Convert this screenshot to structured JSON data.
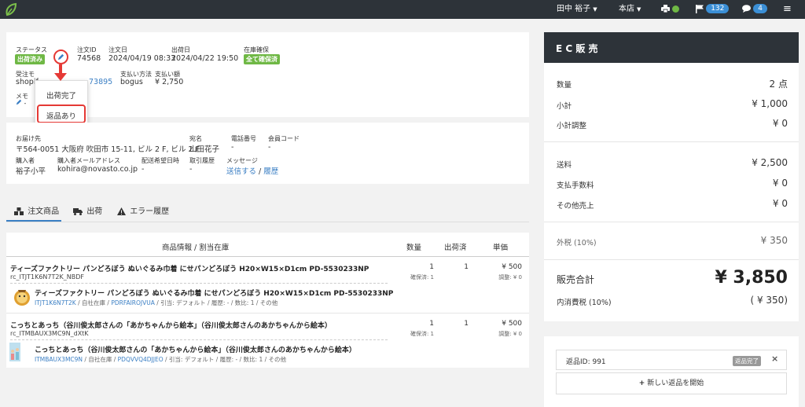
{
  "topbar": {
    "user": "田中 裕子",
    "store": "本店",
    "notifications_count": "132",
    "messages_count": "4",
    "brand_color": "#2d3339",
    "badge_color": "#3b8fd6",
    "status_dot_color": "#6fb845"
  },
  "order": {
    "status_label": "ステータス",
    "status_value": "出荷済み",
    "order_id_label": "注文ID",
    "order_id": "74568",
    "order_date_label": "注文日",
    "order_date": "2024/04/19 08:33",
    "ship_date_label": "出荷日",
    "ship_date": "2024/04/22 19:50",
    "stock_label": "在庫確保",
    "stock_value": "全て確保済",
    "source_label": "受注モ",
    "source_value": "shopif",
    "order_no_fragment": "73895",
    "payment_method_label": "支払い方法",
    "payment_method": "bogus",
    "payment_amount_label": "支払い額",
    "payment_amount": "¥ 2,750",
    "memo_label": "メモ",
    "memo_value": "-"
  },
  "status_menu": {
    "items": [
      "出荷完了",
      "返品あり"
    ]
  },
  "shipping": {
    "address_label": "お届け先",
    "address": "〒564-0051 大阪府 吹田市 15-11, ビル 2 F, ビル 2 F",
    "addressee_label": "宛名",
    "addressee": "山田花子",
    "phone_label": "電話番号",
    "phone": "-",
    "member_label": "会員コード",
    "member": "-",
    "buyer_label": "購入者",
    "buyer": "裕子小平",
    "email_label": "購入者メールアドレス",
    "email": "kohira@novasto.co.jp",
    "delivery_label": "配送希望日時",
    "delivery": "-",
    "history_label": "取引履歴",
    "history": "-",
    "message_label": "メッセージ",
    "message_send": "送信する",
    "message_sep": "/",
    "message_history": "履歴"
  },
  "tabs": [
    "注文商品",
    "出荷",
    "エラー履歴"
  ],
  "table": {
    "headers": [
      "商品情報 / 割当在庫",
      "数量",
      "出荷済",
      "単価"
    ],
    "rows": [
      {
        "title": "ティーズファクトリー パンどろぼう ぬいぐるみ巾着 にせパンどろぼう H20×W15×D1cm PD-5530233NP",
        "sku": "rc_ITJT1K6N7T2K_NBDF",
        "qty": "1",
        "qty_sub": "確保済: 1",
        "shipped": "1",
        "price": "¥ 500",
        "price_sub": "調整: ¥ 0",
        "alloc_title": "ティーズファクトリー パンどろぼう ぬいぐるみ巾着 にせパンどろぼう H20×W15×D1cm PD-5530233NP",
        "alloc_code1": "ITJT1K6N7T2K",
        "alloc_mid": "/ 自社在庫 /",
        "alloc_code2": "PDRFAIROJVUA",
        "alloc_tail": "/ 引当: デフォルト / 履歴: - / 数比: 1 / その他"
      },
      {
        "title": "こっちとあっち（谷川俊太郎さんの「あかちゃんから絵本」（谷川俊太郎さんのあかちゃんから絵本）",
        "sku": "rc_ITMBAUX3MC9N_dXtK",
        "qty": "1",
        "qty_sub": "確保済: 1",
        "shipped": "1",
        "price": "¥ 500",
        "price_sub": "調整: ¥ 0",
        "alloc_title": "こっちとあっち（谷川俊太郎さんの「あかちゃんから絵本」（谷川俊太郎さんのあかちゃんから絵本）",
        "alloc_code1": "ITMBAUX3MC9N",
        "alloc_mid": "/ 自社在庫 /",
        "alloc_code2": "PDQVVQ4DJJEO",
        "alloc_tail": "/ 引当: デフォルト / 履歴: - / 数比: 1 / その他"
      }
    ]
  },
  "summary": {
    "title": "E C 販 売",
    "qty_label": "数量",
    "qty_value": "2 点",
    "subtotal_label": "小計",
    "subtotal_value": "¥ 1,000",
    "adjust_label": "小計調整",
    "adjust_value": "¥ 0",
    "shipping_label": "送料",
    "shipping_value": "¥ 2,500",
    "fee_label": "支払手数料",
    "fee_value": "¥ 0",
    "other_label": "その他売上",
    "other_value": "¥ 0",
    "tax_out_label": "外税 (10%)",
    "tax_out_value": "¥ 350",
    "total_label": "販売合計",
    "total_value": "¥ 3,850",
    "tax_in_label": "内消費税 (10%)",
    "tax_in_value": "( ¥ 350)"
  },
  "returns": {
    "return_id": "返品ID: 991",
    "status": "返品完了",
    "close": "×",
    "new_return": "新しい返品を開始"
  }
}
